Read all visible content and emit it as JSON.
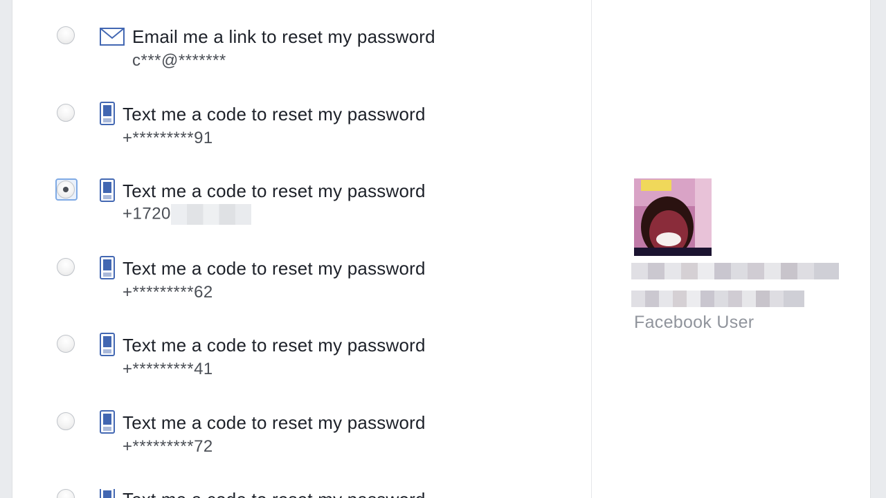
{
  "options": [
    {
      "type": "email",
      "label": "Email me a link to reset my password",
      "sub": "c***@*******",
      "checked": false,
      "icon": "envelope-icon"
    },
    {
      "type": "sms",
      "label": "Text me a code to reset my password",
      "sub": "+*********91",
      "checked": false,
      "icon": "phone-icon"
    },
    {
      "type": "sms",
      "label": "Text me a code to reset my password",
      "sub": "+1720",
      "checked": true,
      "icon": "phone-icon"
    },
    {
      "type": "sms",
      "label": "Text me a code to reset my password",
      "sub": "+*********62",
      "checked": false,
      "icon": "phone-icon"
    },
    {
      "type": "sms",
      "label": "Text me a code to reset my password",
      "sub": "+*********41",
      "checked": false,
      "icon": "phone-icon"
    },
    {
      "type": "sms",
      "label": "Text me a code to reset my password",
      "sub": "+*********72",
      "checked": false,
      "icon": "phone-icon"
    },
    {
      "type": "sms",
      "label": "Text me a code to reset my password",
      "sub": "",
      "checked": false,
      "icon": "phone-icon"
    }
  ],
  "profile": {
    "label": "Facebook User"
  },
  "colors": {
    "background": "#e9ebee",
    "card": "#ffffff",
    "text": "#1d2129",
    "muted": "#90949c",
    "icon": "#4267b2"
  }
}
